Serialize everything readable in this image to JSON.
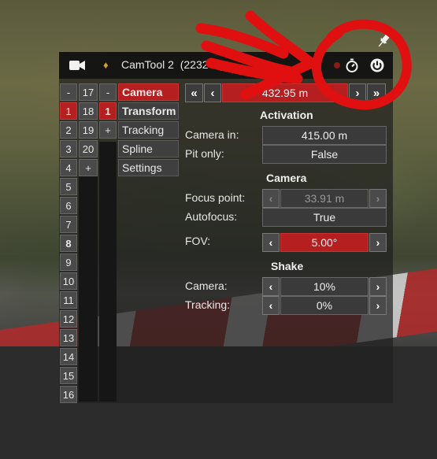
{
  "window": {
    "title": "CamTool 2",
    "subtitle": "(2232 m)",
    "icons": [
      "camera-icon",
      "diamond-icon",
      "stopwatch-icon",
      "power-icon",
      "pin-icon"
    ]
  },
  "camera_list": {
    "col1": [
      "-",
      "1",
      "2",
      "3",
      "4",
      "5",
      "6",
      "7",
      "8",
      "9",
      "10",
      "11",
      "12",
      "13",
      "14",
      "15",
      "16"
    ],
    "col2": [
      "17",
      "18",
      "19",
      "20",
      "+"
    ],
    "col3": [
      "-",
      "1",
      "+"
    ],
    "selected": "1"
  },
  "menu": {
    "items": [
      "Camera",
      "Transform",
      "Tracking",
      "Spline",
      "Settings"
    ],
    "active": "Camera"
  },
  "navigation": {
    "value": "432.95 m",
    "buttons": [
      "«",
      "‹",
      "›",
      "»"
    ]
  },
  "sections": {
    "activation": {
      "title": "Activation",
      "camera_in_label": "Camera in:",
      "camera_in_value": "415.00 m",
      "pit_only_label": "Pit only:",
      "pit_only_value": "False"
    },
    "camera": {
      "title": "Camera",
      "focus_point_label": "Focus point:",
      "focus_point_value": "33.91 m",
      "autofocus_label": "Autofocus:",
      "autofocus_value": "True",
      "fov_label": "FOV:",
      "fov_value": "5.00°"
    },
    "shake": {
      "title": "Shake",
      "camera_label": "Camera:",
      "camera_value": "10%",
      "tracking_label": "Tracking:",
      "tracking_value": "0%"
    }
  },
  "arrows": {
    "left": "‹",
    "right": "›"
  },
  "colors": {
    "accent_red": "#b51f1f",
    "annotation_red": "#e01010",
    "diamond": "#d4a024"
  }
}
